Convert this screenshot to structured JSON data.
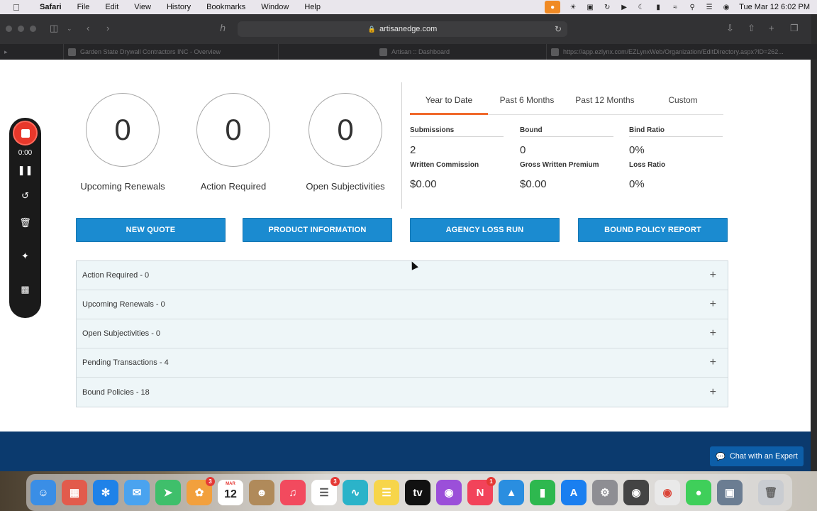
{
  "menubar": {
    "app_name": "Safari",
    "menus": [
      "File",
      "Edit",
      "View",
      "History",
      "Bookmarks",
      "Window",
      "Help"
    ],
    "clock": "Tue Mar 12  6:02 PM"
  },
  "browser": {
    "url": "artisanedge.com",
    "tabs": [
      {
        "title": "Garden State Drywall Contractors INC - Overview"
      },
      {
        "title": "Artisan :: Dashboard"
      },
      {
        "title": "https://app.ezlynx.com/EZLynxWeb/Organization/EditDirectory.aspx?ID=262..."
      }
    ]
  },
  "stats": [
    {
      "value": "0",
      "label": "Upcoming Renewals"
    },
    {
      "value": "0",
      "label": "Action Required"
    },
    {
      "value": "0",
      "label": "Open Subjectivities"
    }
  ],
  "period_tabs": [
    {
      "label": "Year to Date",
      "active": true
    },
    {
      "label": "Past 6 Months",
      "active": false
    },
    {
      "label": "Past 12 Months",
      "active": false
    },
    {
      "label": "Custom",
      "active": false
    }
  ],
  "metrics": [
    {
      "label": "Submissions",
      "value": "2"
    },
    {
      "label": "Bound",
      "value": "0"
    },
    {
      "label": "Bind Ratio",
      "value": "0%"
    },
    {
      "label": "Written Commission",
      "value": "$0.00"
    },
    {
      "label": "Gross Written Premium",
      "value": "$0.00"
    },
    {
      "label": "Loss Ratio",
      "value": "0%"
    }
  ],
  "buttons": {
    "new_quote": "NEW QUOTE",
    "product_information": "PRODUCT INFORMATION",
    "agency_loss_run": "AGENCY LOSS RUN",
    "bound_policy_report": "BOUND POLICY REPORT"
  },
  "accordion": [
    {
      "label": "Action Required - 0"
    },
    {
      "label": "Upcoming Renewals - 0"
    },
    {
      "label": "Open Subjectivities - 0"
    },
    {
      "label": "Pending Transactions - 4"
    },
    {
      "label": "Bound Policies - 18"
    }
  ],
  "chat": {
    "label": "Chat with an Expert"
  },
  "recorder": {
    "time": "0:00"
  },
  "dock": {
    "calendar_month": "MAR",
    "calendar_day": "12",
    "badges": {
      "photos": "3",
      "reminders": "3",
      "news": "1"
    }
  }
}
